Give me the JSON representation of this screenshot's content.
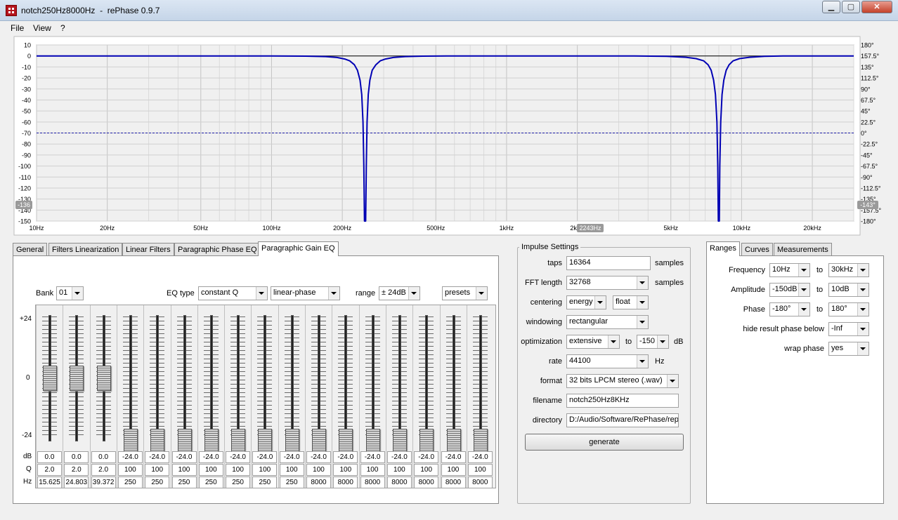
{
  "window": {
    "title": "notch250Hz8000Hz  -  rePhase 0.9.7"
  },
  "menu": [
    "File",
    "View",
    "?"
  ],
  "chart_data": {
    "type": "line",
    "title": "",
    "xlabel": "",
    "ylabel": "",
    "x_scale": "log",
    "xlim": [
      10,
      30000
    ],
    "ylim": [
      -150,
      10
    ],
    "y2lim": [
      -180,
      180
    ],
    "grid": true,
    "x_ticks": [
      {
        "v": 10,
        "label": "10Hz"
      },
      {
        "v": 20,
        "label": "20Hz"
      },
      {
        "v": 50,
        "label": "50Hz"
      },
      {
        "v": 100,
        "label": "100Hz"
      },
      {
        "v": 200,
        "label": "200Hz"
      },
      {
        "v": 500,
        "label": "500Hz"
      },
      {
        "v": 1000,
        "label": "1kHz"
      },
      {
        "v": 2000,
        "label": "2kHz"
      },
      {
        "v": 5000,
        "label": "5kHz"
      },
      {
        "v": 10000,
        "label": "10kHz"
      },
      {
        "v": 20000,
        "label": "20kHz"
      }
    ],
    "y_ticks": [
      10,
      0,
      -10,
      -20,
      -30,
      -40,
      -50,
      -60,
      -70,
      -80,
      -90,
      -100,
      -110,
      -120,
      -130,
      -140,
      -150
    ],
    "y2_ticks": [
      {
        "v": 180,
        "label": "180°"
      },
      {
        "v": 157.5,
        "label": "157.5°"
      },
      {
        "v": 135,
        "label": "135°"
      },
      {
        "v": 112.5,
        "label": "112.5°"
      },
      {
        "v": 90,
        "label": "90°"
      },
      {
        "v": 67.5,
        "label": "67.5°"
      },
      {
        "v": 45,
        "label": "45°"
      },
      {
        "v": 22.5,
        "label": "22.5°"
      },
      {
        "v": 0,
        "label": "0°"
      },
      {
        "v": -22.5,
        "label": "-22.5°"
      },
      {
        "v": -45,
        "label": "-45°"
      },
      {
        "v": -67.5,
        "label": "-67.5°"
      },
      {
        "v": -90,
        "label": "-90°"
      },
      {
        "v": -112.5,
        "label": "-112.5°"
      },
      {
        "v": -135,
        "label": "-135°"
      },
      {
        "v": -157.5,
        "label": "-157.5°"
      },
      {
        "v": -180,
        "label": "-180°"
      }
    ],
    "series": [
      {
        "color": "#0000b4",
        "points": [
          [
            10,
            0
          ],
          [
            30,
            0
          ],
          [
            60,
            0
          ],
          [
            100,
            0
          ],
          [
            140,
            -0.2
          ],
          [
            170,
            -0.6
          ],
          [
            190,
            -1.4
          ],
          [
            205,
            -2.8
          ],
          [
            215,
            -4.5
          ],
          [
            225,
            -8
          ],
          [
            232,
            -13
          ],
          [
            238,
            -22
          ],
          [
            242,
            -35
          ],
          [
            245,
            -60
          ],
          [
            247,
            -100
          ],
          [
            248.5,
            -150
          ],
          [
            251.5,
            -150
          ],
          [
            253,
            -100
          ],
          [
            255,
            -60
          ],
          [
            258,
            -35
          ],
          [
            262,
            -22
          ],
          [
            268,
            -13
          ],
          [
            278,
            -8
          ],
          [
            290,
            -4.5
          ],
          [
            305,
            -2.8
          ],
          [
            330,
            -1.4
          ],
          [
            370,
            -0.6
          ],
          [
            440,
            -0.2
          ],
          [
            600,
            0
          ],
          [
            1500,
            0
          ],
          [
            3500,
            -0.1
          ],
          [
            4800,
            -0.4
          ],
          [
            5800,
            -1.2
          ],
          [
            6400,
            -2.4
          ],
          [
            6900,
            -4.5
          ],
          [
            7200,
            -8
          ],
          [
            7420,
            -13
          ],
          [
            7600,
            -22
          ],
          [
            7740,
            -35
          ],
          [
            7850,
            -60
          ],
          [
            7920,
            -100
          ],
          [
            7960,
            -150
          ],
          [
            8040,
            -150
          ],
          [
            8080,
            -100
          ],
          [
            8150,
            -60
          ],
          [
            8260,
            -35
          ],
          [
            8400,
            -22
          ],
          [
            8600,
            -13
          ],
          [
            8850,
            -8
          ],
          [
            9200,
            -4.5
          ],
          [
            9800,
            -2.4
          ],
          [
            10800,
            -1.2
          ],
          [
            12500,
            -0.4
          ],
          [
            15000,
            -0.1
          ],
          [
            20000,
            0
          ],
          [
            30000,
            0
          ]
        ]
      }
    ],
    "phase_line": {
      "value": 0,
      "color": "#1a1aa6"
    },
    "markers": {
      "left": "-136",
      "right": "-143°",
      "bottom": "2243Hz"
    }
  },
  "left_tabs": [
    "General",
    "Filters Linearization",
    "Linear Filters",
    "Paragraphic Phase EQ",
    "Paragraphic Gain EQ"
  ],
  "eq": {
    "bank_label": "Bank",
    "bank": "01",
    "eqtype_label": "EQ type",
    "eqtype": "constant Q",
    "phase_mode": "linear-phase",
    "range_label": "range",
    "range": "± 24dB",
    "presets": "presets",
    "scale": [
      "+24",
      "0",
      "-24"
    ],
    "row_labels": [
      "dB",
      "Q",
      "Hz"
    ],
    "channels": [
      {
        "db": "0.0",
        "q": "2.0",
        "hz": "15.625",
        "gain": 0.0
      },
      {
        "db": "0.0",
        "q": "2.0",
        "hz": "24.803",
        "gain": 0.0
      },
      {
        "db": "0.0",
        "q": "2.0",
        "hz": "39.372",
        "gain": 0.0
      },
      {
        "db": "-24.0",
        "q": "100",
        "hz": "250",
        "gain": -24.0
      },
      {
        "db": "-24.0",
        "q": "100",
        "hz": "250",
        "gain": -24.0
      },
      {
        "db": "-24.0",
        "q": "100",
        "hz": "250",
        "gain": -24.0
      },
      {
        "db": "-24.0",
        "q": "100",
        "hz": "250",
        "gain": -24.0
      },
      {
        "db": "-24.0",
        "q": "100",
        "hz": "250",
        "gain": -24.0
      },
      {
        "db": "-24.0",
        "q": "100",
        "hz": "250",
        "gain": -24.0
      },
      {
        "db": "-24.0",
        "q": "100",
        "hz": "250",
        "gain": -24.0
      },
      {
        "db": "-24.0",
        "q": "100",
        "hz": "8000",
        "gain": -24.0
      },
      {
        "db": "-24.0",
        "q": "100",
        "hz": "8000",
        "gain": -24.0
      },
      {
        "db": "-24.0",
        "q": "100",
        "hz": "8000",
        "gain": -24.0
      },
      {
        "db": "-24.0",
        "q": "100",
        "hz": "8000",
        "gain": -24.0
      },
      {
        "db": "-24.0",
        "q": "100",
        "hz": "8000",
        "gain": -24.0
      },
      {
        "db": "-24.0",
        "q": "100",
        "hz": "8000",
        "gain": -24.0
      },
      {
        "db": "-24.0",
        "q": "100",
        "hz": "8000",
        "gain": -24.0
      }
    ]
  },
  "impulse": {
    "title": "Impulse Settings",
    "taps_label": "taps",
    "taps": "16364",
    "taps_unit": "samples",
    "fft_label": "FFT length",
    "fft": "32768",
    "fft_unit": "samples",
    "centering_label": "centering",
    "centering": "energy",
    "centering_mode": "float",
    "windowing_label": "windowing",
    "windowing": "rectangular",
    "optimization_label": "optimization",
    "optimization": "extensive",
    "opt_to": "to",
    "opt_value": "-150",
    "opt_unit": "dB",
    "rate_label": "rate",
    "rate": "44100",
    "rate_unit": "Hz",
    "format_label": "format",
    "format": "32 bits LPCM stereo (.wav)",
    "filename_label": "filename",
    "filename": "notch250Hz8KHz",
    "directory_label": "directory",
    "directory": "D:/Audio/Software/RePhase/repl",
    "generate": "generate"
  },
  "right_tabs": [
    "Ranges",
    "Curves",
    "Measurements"
  ],
  "ranges": {
    "frequency_label": "Frequency",
    "frequency_from": "10Hz",
    "frequency_to": "30kHz",
    "amplitude_label": "Amplitude",
    "amplitude_from": "-150dB",
    "amplitude_to": "10dB",
    "phase_label": "Phase",
    "phase_from": "-180°",
    "phase_to": "180°",
    "to": "to",
    "hide_label": "hide result phase below",
    "hide_value": "-Inf",
    "wrap_label": "wrap phase",
    "wrap_value": "yes"
  }
}
